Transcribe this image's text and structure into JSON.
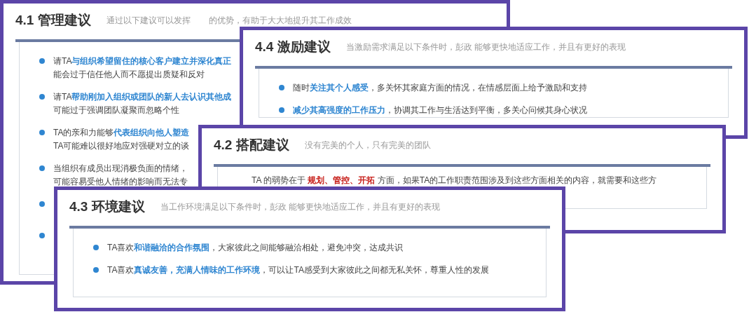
{
  "cards": [
    {
      "title": "4.1 管理建议",
      "subtitle": [
        "通过以下建议可以发挥",
        "的优势，有助于大大地提升其工作成效"
      ],
      "items": [
        {
          "kind": "bullet",
          "lines": [
            "请TA**与组织希望留住的核心客户建立并深化真正**",
            "能会过于信任他人而不愿提出质疑和反对"
          ]
        },
        {
          "kind": "bullet",
          "lines": [
            "请TA**帮助刚加入组织或团队的新人去认识其他成**",
            "可能过于强调团队凝聚而忽略个性"
          ]
        },
        {
          "kind": "bullet",
          "lines": [
            "TA的亲和力能够**代表组织向他人塑造**",
            "TA可能难以很好地应对强硬对立的谈"
          ]
        },
        {
          "kind": "bullet",
          "lines": [
            "当组织有成员出现消极负面的情绪，",
            "可能容易受他人情绪的影响而无法专"
          ]
        },
        {
          "kind": "bullet_only"
        },
        {
          "kind": "bullet_only"
        }
      ]
    },
    {
      "title": "4.4 激励建议",
      "subtitle": [
        "当激励需求满足以下条件时，彭政 能够更快地适应工作，并且有更好的表现"
      ],
      "items": [
        {
          "kind": "bullet",
          "lines": [
            "随时**关注其个人感受**，多关怀其家庭方面的情况，在情感层面上给予激励和支持"
          ]
        },
        {
          "kind": "bullet",
          "lines": [
            "**减少其高强度的工作压力**，协调其工作与生活达到平衡，多关心问候其身心状况"
          ]
        }
      ]
    },
    {
      "title": "4.2 搭配建议",
      "subtitle": [
        "没有完美的个人，只有完美的团队"
      ],
      "items": [
        {
          "kind": "paragraph",
          "lines": [
            "TA 的弱势在于 **规划、管控、开拓** 方面，如果TA的工作职责范围涉及到这些方面相关的内容，就需要和这些方"
          ]
        }
      ]
    },
    {
      "title": "4.3 环境建议",
      "subtitle": [
        "当工作环境满足以下条件时，彭政 能够更快地适应工作，并且有更好的表现"
      ],
      "items": [
        {
          "kind": "bullet",
          "lines": [
            "TA喜欢**和谐融洽的合作氛围**，大家彼此之间能够融洽相处，避免冲突，达成共识"
          ]
        },
        {
          "kind": "bullet",
          "lines": [
            "TA喜欢**真诚友善，充满人情味的工作环境**，可以让TA感受到大家彼此之间都无私关怀，尊重人性的发展"
          ]
        }
      ]
    }
  ]
}
